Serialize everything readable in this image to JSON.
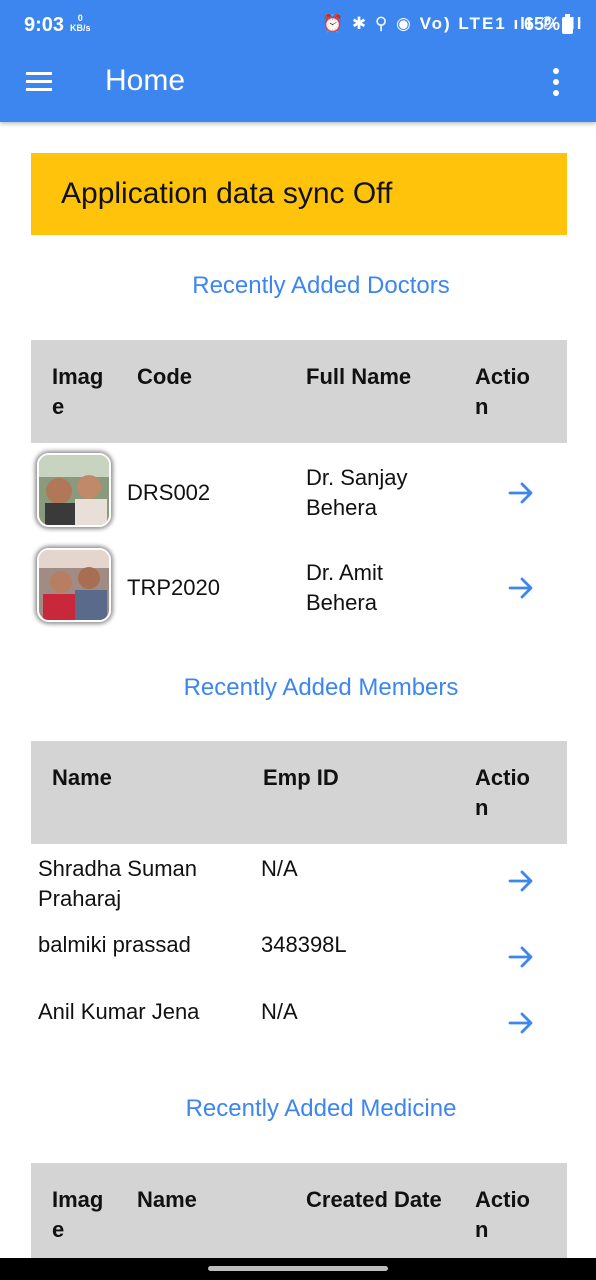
{
  "status_bar": {
    "time": "9:03",
    "net_speed_value": "0",
    "net_speed_unit": "KB/s",
    "icons": "⏰ ✱ ⚲ ◉ Vo) LTE1 ıll ✆ ıll",
    "battery": "65%"
  },
  "app_bar": {
    "title": "Home",
    "menu_icon": "hamburger-icon",
    "more_icon": "more-vert-icon"
  },
  "banner": {
    "text": "Application data sync Off",
    "color": "#ffc30b"
  },
  "colors": {
    "primary": "#3d86f0",
    "header_bg": "#d4d4d4"
  },
  "doctors": {
    "title": "Recently Added Doctors",
    "columns": [
      "Image",
      "Code",
      "Full Name",
      "Action"
    ],
    "rows": [
      {
        "code": "DRS002",
        "name_line1": "Dr. Sanjay",
        "name_line2": "Behera"
      },
      {
        "code": "TRP2020",
        "name_line1": "Dr. Amit",
        "name_line2": "Behera"
      }
    ]
  },
  "members": {
    "title": "Recently Added Members",
    "columns": [
      "Name",
      "Emp ID",
      "Action"
    ],
    "rows": [
      {
        "name_line1": "Shradha Suman",
        "name_line2": "Praharaj",
        "emp_id": "N/A"
      },
      {
        "name_line1": "balmiki prassad",
        "name_line2": "",
        "emp_id": "348398L"
      },
      {
        "name_line1": "Anil Kumar Jena",
        "name_line2": "",
        "emp_id": "N/A"
      }
    ]
  },
  "medicine": {
    "title": "Recently Added Medicine",
    "columns": [
      "Image",
      "Name",
      "Created Date",
      "Action"
    ]
  }
}
